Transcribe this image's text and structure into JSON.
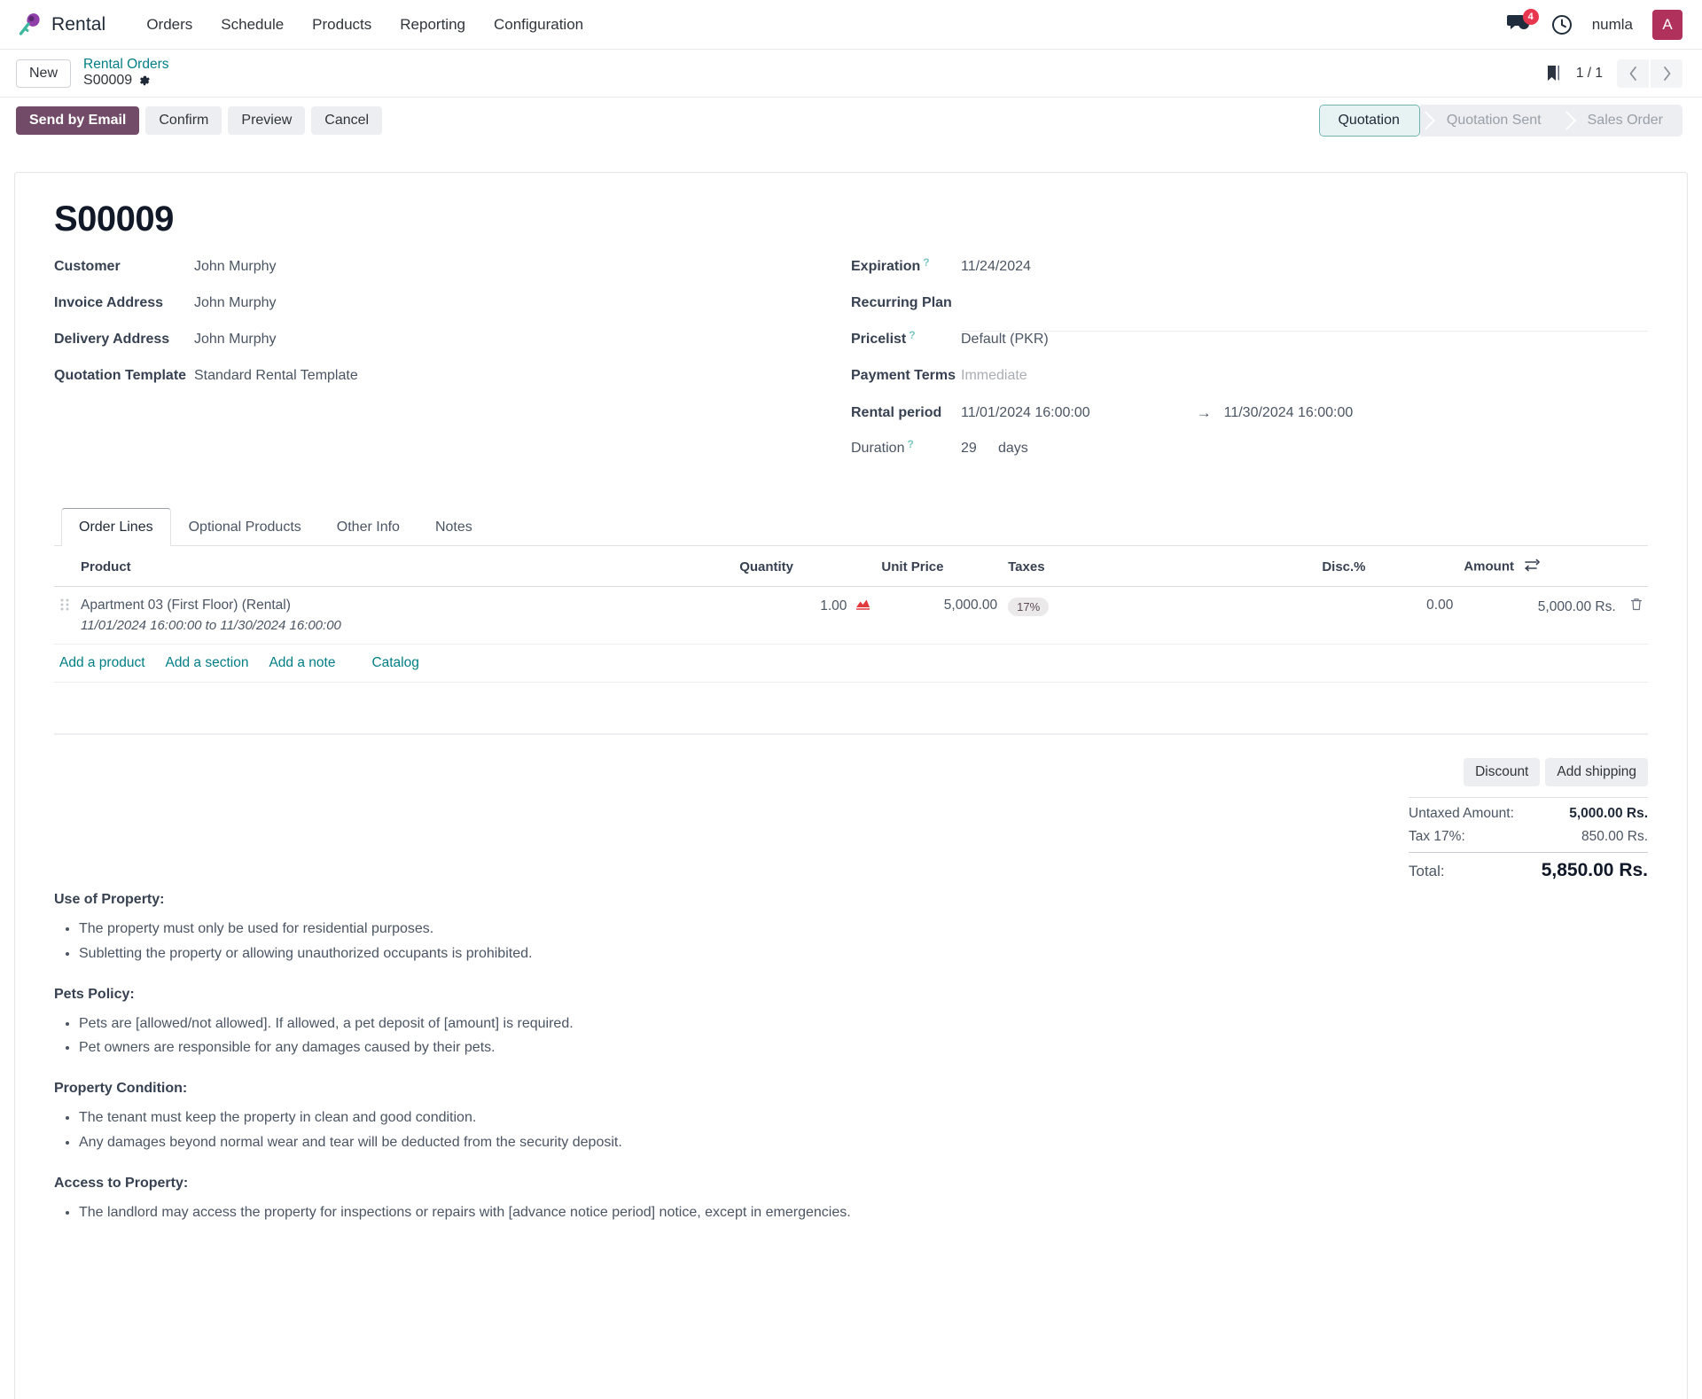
{
  "navbar": {
    "brand": "Rental",
    "brand_logo_icon": "rental-key-icon",
    "menu": [
      {
        "label": "Orders",
        "name": "nav-orders"
      },
      {
        "label": "Schedule",
        "name": "nav-schedule"
      },
      {
        "label": "Products",
        "name": "nav-products"
      },
      {
        "label": "Reporting",
        "name": "nav-reporting"
      },
      {
        "label": "Configuration",
        "name": "nav-configuration"
      }
    ],
    "messages_icon": "messages-icon",
    "messages_count": "4",
    "activity_icon": "clock-icon",
    "user": "numla",
    "avatar_initial": "A",
    "avatar_color": "#b0315c"
  },
  "breadcrumb": {
    "new_label": "New",
    "parent": "Rental Orders",
    "current": "S00009",
    "settings_icon": "gear-icon",
    "bookmark_icon": "bookmark-icon",
    "pager": "1 / 1",
    "prev_icon": "chevron-left-icon",
    "next_icon": "chevron-right-icon"
  },
  "actions": {
    "primary": "Send by Email",
    "buttons": [
      "Confirm",
      "Preview",
      "Cancel"
    ]
  },
  "statusbar": {
    "steps": [
      {
        "label": "Quotation",
        "active": true
      },
      {
        "label": "Quotation Sent",
        "active": false
      },
      {
        "label": "Sales Order",
        "active": false
      }
    ],
    "active_color": "#e7f3f2",
    "active_border": "#6fb3ae"
  },
  "record": {
    "title": "S00009",
    "left_fields": [
      {
        "label": "Customer",
        "value": "John Murphy",
        "help": false
      },
      {
        "label": "Invoice Address",
        "value": "John Murphy",
        "help": false
      },
      {
        "label": "Delivery Address",
        "value": "John Murphy",
        "help": false
      },
      {
        "label": "Quotation Template",
        "value": "Standard Rental Template",
        "help": false
      }
    ],
    "right_fields": {
      "expiration_label": "Expiration",
      "expiration_value": "11/24/2024",
      "recurring_label": "Recurring Plan",
      "recurring_value": "",
      "pricelist_label": "Pricelist",
      "pricelist_value": "Default (PKR)",
      "payment_terms_label": "Payment Terms",
      "payment_terms_value": "Immediate",
      "rental_period_label": "Rental period",
      "rental_start": "11/01/2024 16:00:00",
      "rental_end": "11/30/2024 16:00:00",
      "arrow": "→",
      "duration_label": "Duration",
      "duration_value": "29",
      "duration_unit": "days"
    }
  },
  "notebook": {
    "tabs": [
      {
        "label": "Order Lines",
        "active": true
      },
      {
        "label": "Optional Products",
        "active": false
      },
      {
        "label": "Other Info",
        "active": false
      },
      {
        "label": "Notes",
        "active": false
      }
    ]
  },
  "order_lines": {
    "columns": {
      "product": "Product",
      "quantity": "Quantity",
      "unit_price": "Unit Price",
      "taxes": "Taxes",
      "discount": "Disc.%",
      "amount": "Amount"
    },
    "optional_columns_icon": "column-options-icon",
    "rows": [
      {
        "drag_icon": "drag-handle-icon",
        "product": "Apartment 03 (First Floor) (Rental)",
        "period": "11/01/2024 16:00:00 to 11/30/2024 16:00:00",
        "quantity": "1.00",
        "forecast_icon": "availability-chart-icon",
        "unit_price": "5,000.00",
        "tax": "17%",
        "discount": "0.00",
        "amount": "5,000.00 Rs.",
        "delete_icon": "trash-icon"
      }
    ],
    "add_links": [
      {
        "label": "Add a product",
        "name": "add-a-product-link"
      },
      {
        "label": "Add a section",
        "name": "add-a-section-link"
      },
      {
        "label": "Add a note",
        "name": "add-a-note-link"
      },
      {
        "label": "Catalog",
        "name": "catalog-link"
      }
    ]
  },
  "totals": {
    "discount_button": "Discount",
    "shipping_button": "Add shipping",
    "untaxed_label": "Untaxed Amount:",
    "untaxed_value": "5,000.00 Rs.",
    "tax_label": "Tax 17%:",
    "tax_value": "850.00 Rs.",
    "total_label": "Total:",
    "total_value": "5,850.00 Rs."
  },
  "terms": [
    {
      "heading": "Use of Property:",
      "items": [
        "The property must only be used for residential purposes.",
        "Subletting the property or allowing unauthorized occupants is prohibited."
      ]
    },
    {
      "heading": "Pets Policy:",
      "items": [
        "Pets are [allowed/not allowed]. If allowed, a pet deposit of [amount] is required.",
        "Pet owners are responsible for any damages caused by their pets."
      ]
    },
    {
      "heading": "Property Condition:",
      "items": [
        "The tenant must keep the property in clean and good condition.",
        "Any damages beyond normal wear and tear will be deducted from the security deposit."
      ]
    },
    {
      "heading": "Access to Property:",
      "items": [
        "The landlord may access the property for inspections or repairs with [advance notice period] notice, except in emergencies."
      ]
    }
  ]
}
